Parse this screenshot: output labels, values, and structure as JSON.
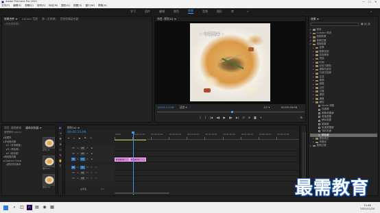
{
  "window": {
    "title": "Adobe Premiere Pro 2020",
    "app_icon": "premiere-icon",
    "minimize": "—",
    "maximize": "☐",
    "close": "✕"
  },
  "menu": [
    "文件(F)",
    "编辑(E)",
    "剪辑(C)",
    "序列(S)",
    "标记(M)",
    "图形(G)",
    "视图(V)",
    "窗口(W)",
    "帮助(H)"
  ],
  "workspaces": {
    "items": [
      "学习",
      "组件",
      "编辑",
      "颜色",
      "效果",
      "音频",
      "图形",
      "库"
    ],
    "active": 4,
    "more": "»",
    "search_icon": "⌕"
  },
  "source_panel": {
    "tabs": [
      "效果控件 ≡",
      "Lumetri 范围",
      "源: (无剪辑)",
      "音频剪辑混合器"
    ],
    "empty_text": "(未选择剪辑)"
  },
  "program": {
    "tab": "节目: 序列 01 ≡",
    "overlay_text": "• 今日周末 •",
    "timecode": "00:00:13:09",
    "zoom": "适合",
    "quality": "1/2",
    "duration": "00:00:26:08",
    "position_seconds": 13.4,
    "duration_seconds": 26.3,
    "buttons": [
      "{",
      "}",
      "|◀",
      "◀▮",
      "▶",
      "▮▶",
      "▶|",
      "⊟",
      "⊞",
      "◙",
      "+"
    ],
    "wrench": "⚙"
  },
  "effects": {
    "tab": "效果 ≡",
    "icons": "▣ ▤ ▥",
    "items": [
      {
        "label": "预设",
        "level": 0,
        "open": false
      },
      {
        "label": "Lumetri 预设",
        "level": 0,
        "open": false
      },
      {
        "label": "音频效果",
        "level": 0,
        "open": false
      },
      {
        "label": "音频过渡",
        "level": 0,
        "open": false
      },
      {
        "label": "视频效果",
        "level": 0,
        "open": true
      },
      {
        "label": "变换",
        "level": 1,
        "open": false
      },
      {
        "label": "图像控制",
        "level": 1,
        "open": false
      },
      {
        "label": "实用程序",
        "level": 1,
        "open": false
      },
      {
        "label": "扭曲",
        "level": 1,
        "open": false
      },
      {
        "label": "时间",
        "level": 1,
        "open": false
      },
      {
        "label": "杂色与颗粒",
        "level": 1,
        "open": false
      },
      {
        "label": "模糊与锐化",
        "level": 1,
        "open": false
      },
      {
        "label": "沉浸式视频",
        "level": 1,
        "open": false
      },
      {
        "label": "生成",
        "level": 1,
        "open": false
      },
      {
        "label": "视频",
        "level": 1,
        "open": false
      },
      {
        "label": "调整",
        "level": 1,
        "open": false
      },
      {
        "label": "过时",
        "level": 1,
        "open": false
      },
      {
        "label": "过渡",
        "level": 1,
        "open": false
      },
      {
        "label": "透视",
        "level": 1,
        "open": false
      },
      {
        "label": "通道",
        "level": 1,
        "open": false
      },
      {
        "label": "键控",
        "level": 1,
        "open": true
      },
      {
        "label": "Alpha 调整",
        "level": 2,
        "leaf": true
      },
      {
        "label": "亮度键",
        "level": 2,
        "leaf": true
      },
      {
        "label": "图像遮罩键",
        "level": 2,
        "leaf": true
      },
      {
        "label": "差值遮罩",
        "level": 2,
        "leaf": true
      },
      {
        "label": "移除遮罩",
        "level": 2,
        "leaf": true
      },
      {
        "label": "超级键",
        "level": 2,
        "leaf": true
      },
      {
        "label": "轨道遮罩键",
        "level": 2,
        "leaf": true
      },
      {
        "label": "非红色键",
        "level": 2,
        "leaf": true
      },
      {
        "label": "颜色键",
        "level": 2,
        "leaf": true,
        "selected": true
      },
      {
        "label": "颜色校正",
        "level": 1,
        "open": false
      },
      {
        "label": "风格化",
        "level": 1,
        "open": false
      },
      {
        "label": "视频过渡",
        "level": 0,
        "open": false
      }
    ]
  },
  "project": {
    "tabs": [
      "项目: 最需教育",
      "媒体浏览器 ≡"
    ],
    "path": "最需教育.prproj",
    "tree": [
      {
        "label": "收藏夹",
        "level": 0
      },
      {
        "label": "本地驱动器",
        "level": 0
      },
      {
        "label": "C: (本地磁盘)",
        "level": 1
      },
      {
        "label": "D: (新加卷)",
        "level": 1
      },
      {
        "label": "E: (新加卷)",
        "level": 1
      },
      {
        "label": "网络驱动器",
        "level": 0
      },
      {
        "label": "Creative Cloud",
        "level": 0
      },
      {
        "label": "团队项目版本",
        "level": 1
      }
    ],
    "thumbs": [
      "序列 01",
      "素材 01",
      "素材 02"
    ]
  },
  "tools": [
    "▶",
    "⇥",
    "✥",
    "⊕",
    "⇿",
    "✎",
    "✋",
    "T"
  ],
  "timeline": {
    "tab": "序列 01 ≡",
    "timecode": "00:00:15:09",
    "position_seconds": 15.4,
    "toolbar_icons": "⇥ ∩ ◆ ⚑ ✎",
    "ruler_interval_seconds": 15,
    "ruler": [
      "00:00",
      "00:00:15:00",
      "00:00:30:00",
      "00:00:45:00",
      "00:01:00:00",
      "00:01:15:00",
      "00:01:30:00",
      "00:01:45:00",
      "00:02:00:00",
      "00:02:15:00"
    ],
    "tracks": [
      {
        "name": "V3",
        "type": "video"
      },
      {
        "name": "V2",
        "type": "video"
      },
      {
        "name": "V1",
        "type": "video",
        "active": true
      },
      {
        "name": "A1",
        "type": "audio",
        "active": true
      },
      {
        "name": "A2",
        "type": "audio"
      },
      {
        "name": "A3",
        "type": "audio"
      }
    ],
    "clips": [
      {
        "track": "V1",
        "start": 0,
        "end": 12.6,
        "label": "fx 序列 01"
      },
      {
        "track": "V1",
        "start": 12.6,
        "end": 26.3,
        "label": "fx 序列 01"
      }
    ],
    "master": "主声道",
    "master_value": "0.0"
  },
  "taskbar": {
    "start_icon": "windows-icon",
    "apps": [
      "⌕",
      "◫",
      "Pr",
      "▤",
      "◉",
      "▦"
    ],
    "time": "11:48",
    "date": "2021/11/24"
  },
  "watermark": "最需教育"
}
